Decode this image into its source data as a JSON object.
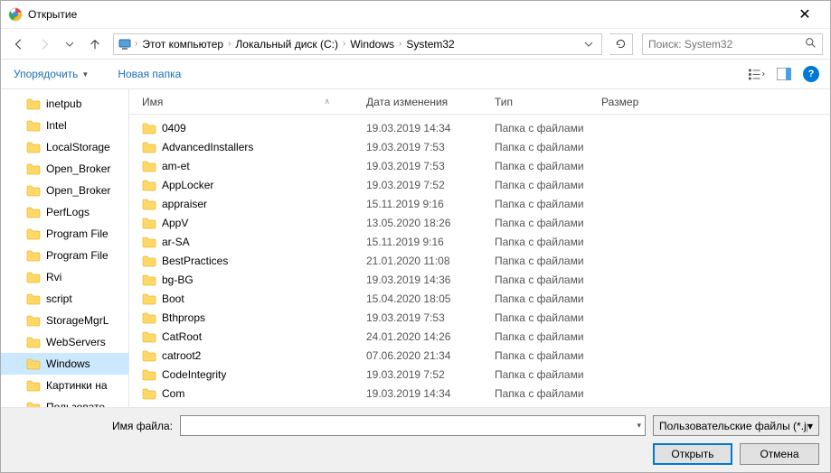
{
  "window": {
    "title": "Открытие"
  },
  "nav": {
    "breadcrumbs": [
      "Этот компьютер",
      "Локальный диск (C:)",
      "Windows",
      "System32"
    ],
    "search_placeholder": "Поиск: System32"
  },
  "toolbar": {
    "organize": "Упорядочить",
    "new_folder": "Новая папка"
  },
  "columns": {
    "name": "Имя",
    "date": "Дата изменения",
    "type": "Тип",
    "size": "Размер"
  },
  "tree": [
    {
      "label": "inetpub"
    },
    {
      "label": "Intel"
    },
    {
      "label": "LocalStorage"
    },
    {
      "label": "Open_Broker"
    },
    {
      "label": "Open_Broker"
    },
    {
      "label": "PerfLogs"
    },
    {
      "label": "Program File"
    },
    {
      "label": "Program File"
    },
    {
      "label": "Rvi"
    },
    {
      "label": "script"
    },
    {
      "label": "StorageMgrL"
    },
    {
      "label": "WebServers"
    },
    {
      "label": "Windows",
      "selected": true
    },
    {
      "label": "Картинки на"
    },
    {
      "label": "Пользовате"
    }
  ],
  "files": [
    {
      "name": "0409",
      "date": "19.03.2019 14:34",
      "type": "Папка с файлами"
    },
    {
      "name": "AdvancedInstallers",
      "date": "19.03.2019 7:53",
      "type": "Папка с файлами"
    },
    {
      "name": "am-et",
      "date": "19.03.2019 7:53",
      "type": "Папка с файлами"
    },
    {
      "name": "AppLocker",
      "date": "19.03.2019 7:52",
      "type": "Папка с файлами"
    },
    {
      "name": "appraiser",
      "date": "15.11.2019 9:16",
      "type": "Папка с файлами"
    },
    {
      "name": "AppV",
      "date": "13.05.2020 18:26",
      "type": "Папка с файлами"
    },
    {
      "name": "ar-SA",
      "date": "15.11.2019 9:16",
      "type": "Папка с файлами"
    },
    {
      "name": "BestPractices",
      "date": "21.01.2020 11:08",
      "type": "Папка с файлами"
    },
    {
      "name": "bg-BG",
      "date": "19.03.2019 14:36",
      "type": "Папка с файлами"
    },
    {
      "name": "Boot",
      "date": "15.04.2020 18:05",
      "type": "Папка с файлами"
    },
    {
      "name": "Bthprops",
      "date": "19.03.2019 7:53",
      "type": "Папка с файлами"
    },
    {
      "name": "CatRoot",
      "date": "24.01.2020 14:26",
      "type": "Папка с файлами"
    },
    {
      "name": "catroot2",
      "date": "07.06.2020 21:34",
      "type": "Папка с файлами"
    },
    {
      "name": "CodeIntegrity",
      "date": "19.03.2019 7:52",
      "type": "Папка с файлами"
    },
    {
      "name": "Com",
      "date": "19.03.2019 14:34",
      "type": "Папка с файлами"
    }
  ],
  "footer": {
    "filename_label": "Имя файла:",
    "filter": "Пользовательские файлы (*.jp",
    "open": "Открыть",
    "cancel": "Отмена"
  }
}
